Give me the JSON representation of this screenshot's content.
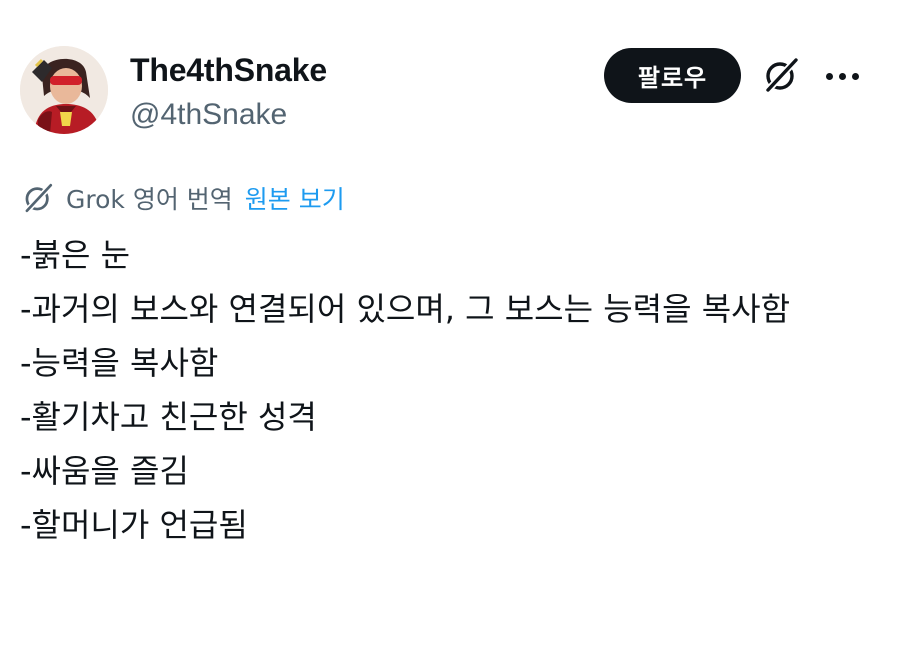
{
  "author": {
    "display_name": "The4thSnake",
    "handle": "@4thSnake"
  },
  "actions": {
    "follow_label": "팔로우",
    "grok_icon": "grok-icon",
    "more_icon": "more-horizontal-icon"
  },
  "translation": {
    "label": "Grok 영어 번역",
    "show_original": "원본 보기"
  },
  "post": {
    "lines": [
      "-붉은 눈",
      "-과거의 보스와 연결되어 있으며, 그 보스는 능력을 복사함",
      "-능력을 복사함",
      "-활기차고 친근한 성격",
      "-싸움을 즐김",
      "-할머니가 언급됨"
    ]
  },
  "colors": {
    "text_primary": "#0f1419",
    "text_secondary": "#536471",
    "link": "#1d9bf0",
    "follow_bg": "#0f1419",
    "background": "#ffffff"
  }
}
